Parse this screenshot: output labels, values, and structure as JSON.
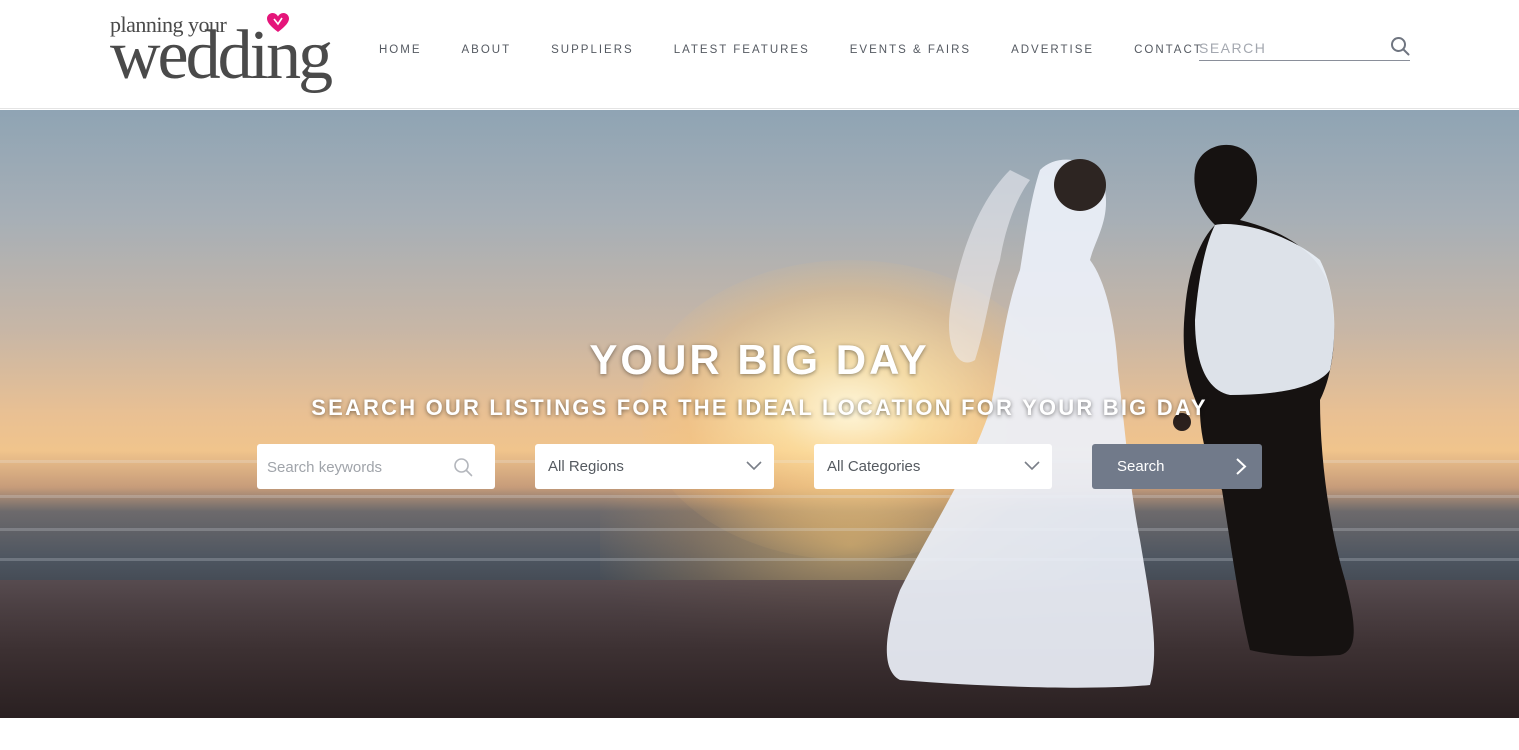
{
  "logo": {
    "small": "planning your",
    "big": "wedding"
  },
  "nav": {
    "items": [
      {
        "label": "HOME"
      },
      {
        "label": "ABOUT"
      },
      {
        "label": "SUPPLIERS"
      },
      {
        "label": "LATEST FEATURES"
      },
      {
        "label": "EVENTS & FAIRS"
      },
      {
        "label": "ADVERTISE"
      },
      {
        "label": "CONTACT"
      }
    ]
  },
  "header_search": {
    "placeholder": "SEARCH",
    "icon": "search-icon"
  },
  "hero": {
    "title": "YOUR BIG DAY",
    "subtitle": "SEARCH OUR LISTINGS FOR THE IDEAL LOCATION FOR YOUR BIG DAY",
    "keywords_placeholder": "Search keywords",
    "regions_selected": "All Regions",
    "categories_selected": "All Categories",
    "search_button": "Search"
  },
  "colors": {
    "brand_pink": "#e5157a",
    "button_bg": "#717a8a",
    "nav_text": "#555a62"
  }
}
